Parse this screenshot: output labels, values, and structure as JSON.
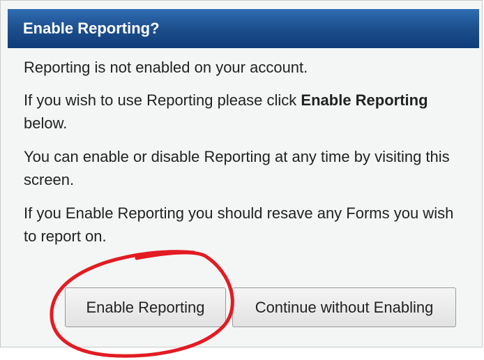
{
  "dialog": {
    "title": "Enable Reporting?",
    "paragraph1": "Reporting is not enabled on your account.",
    "paragraph2_prefix": "If you wish to use Reporting please click ",
    "paragraph2_bold": "Enable Reporting",
    "paragraph2_suffix": " below.",
    "paragraph3": "You can enable or disable Reporting at any time by visiting this screen.",
    "paragraph4": "If you Enable Reporting you should resave any Forms you wish to report on.",
    "buttons": {
      "enable_label": "Enable Reporting",
      "continue_label": "Continue without Enabling"
    }
  },
  "annotation": {
    "circle_color": "#e31b23"
  }
}
